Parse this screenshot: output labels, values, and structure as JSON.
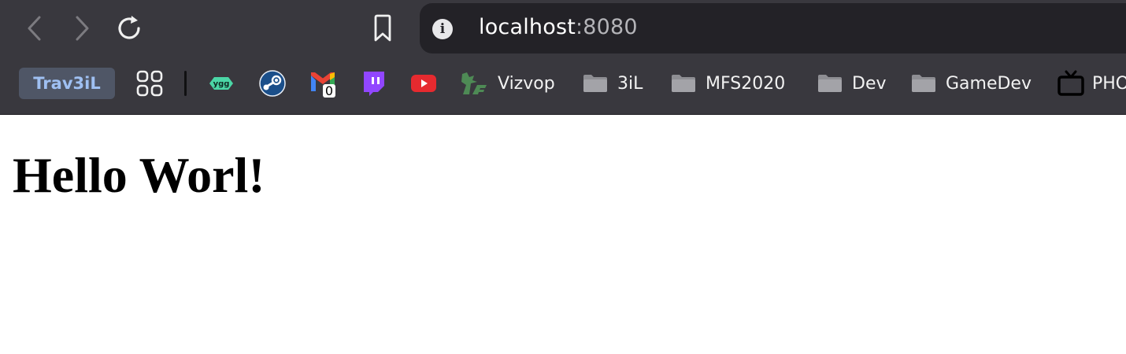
{
  "browser": {
    "url_host": "localhost",
    "url_port": ":8080"
  },
  "bookmarks": {
    "profile": "Trav3iL",
    "ygg_badge": "ygg",
    "gmail_count": "0",
    "items": [
      {
        "label": "Vizvop"
      },
      {
        "label": "3iL"
      },
      {
        "label": "MFS2020"
      },
      {
        "label": "Dev"
      },
      {
        "label": "GameDev"
      },
      {
        "label": "PHO"
      }
    ]
  },
  "page": {
    "heading": "Hello Worl!"
  },
  "colors": {
    "chrome_bg": "#39383e",
    "url_bar_bg": "#232227",
    "profile_bg": "#4f5666",
    "profile_text": "#9fc0f2",
    "youtube_red": "#e62a2f",
    "twitch_purple": "#9146ff",
    "steam_blue": "#1b4f8a",
    "folder_gray": "#8e8e93"
  },
  "icons": {
    "back": "chevron-left-icon",
    "forward": "chevron-right-icon",
    "reload": "reload-icon",
    "bookmark": "bookmark-icon",
    "info": "info-icon",
    "apps": "apps-grid-icon",
    "folder": "folder-icon",
    "tv": "tv-icon"
  }
}
